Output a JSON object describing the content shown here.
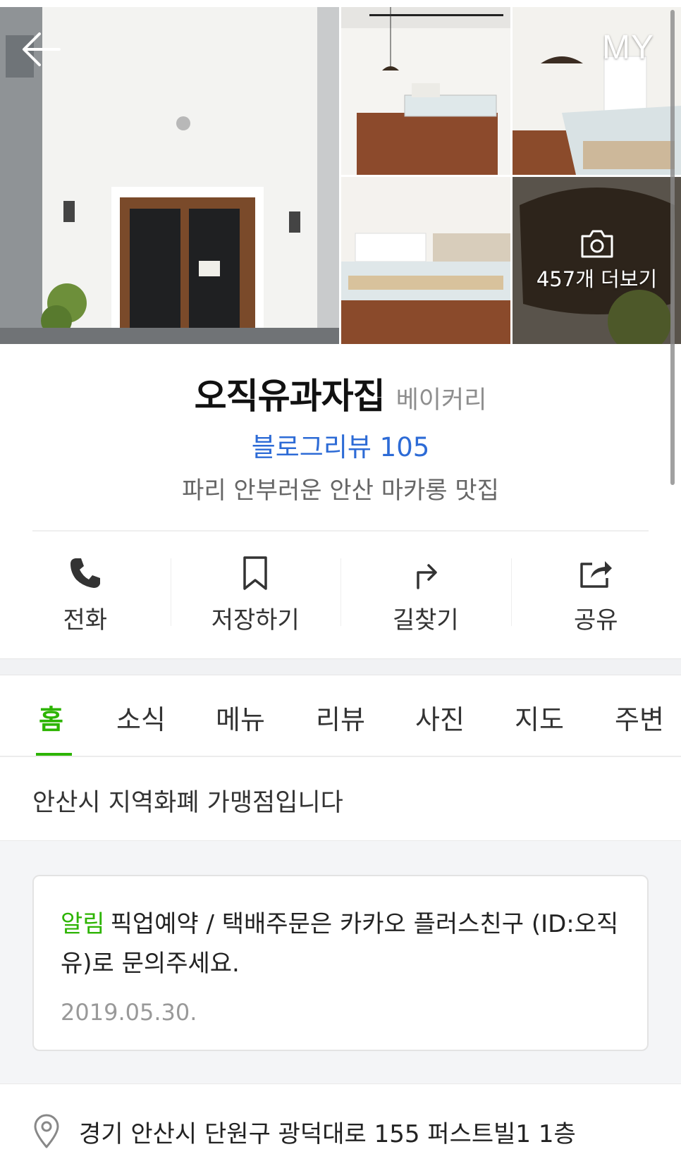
{
  "header": {
    "back_icon": "arrow-left-icon",
    "my_label": "MY"
  },
  "gallery": {
    "more_label": "457개 더보기",
    "camera_icon": "camera-icon"
  },
  "place": {
    "name": "오직유과자집",
    "category": "베이커리",
    "blog_review": "블로그리뷰 105",
    "tagline": "파리 안부러운 안산 마카롱 맛집"
  },
  "actions": [
    {
      "label": "전화",
      "icon": "phone-icon"
    },
    {
      "label": "저장하기",
      "icon": "bookmark-icon"
    },
    {
      "label": "길찾기",
      "icon": "directions-icon"
    },
    {
      "label": "공유",
      "icon": "share-icon"
    }
  ],
  "tabs": [
    {
      "label": "홈",
      "active": true
    },
    {
      "label": "소식"
    },
    {
      "label": "메뉴"
    },
    {
      "label": "리뷰"
    },
    {
      "label": "사진"
    },
    {
      "label": "지도"
    },
    {
      "label": "주변"
    }
  ],
  "info": {
    "local_currency": "안산시 지역화폐 가맹점입니다"
  },
  "notice": {
    "tag": "알림",
    "text": "픽업예약 / 택배주문은 카카오 플러스친구 (ID:오직유)로 문의주세요.",
    "date": "2019.05.30."
  },
  "address": {
    "icon": "location-pin-icon",
    "text": "경기 안산시 단원구 광덕대로 155 퍼스트빌1 1층"
  },
  "colors": {
    "accent": "#2db400",
    "link": "#2d6bd6",
    "muted": "#8e8e8e"
  }
}
